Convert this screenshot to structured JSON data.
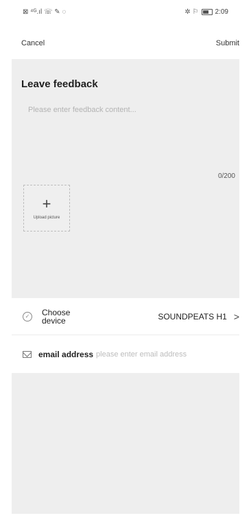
{
  "status_bar": {
    "left_icons": "⊠ ⁴ᴳ.ıl ☏ ✎ ◌",
    "right_icons": "✲ ⚐",
    "time": "2:09"
  },
  "nav": {
    "cancel_label": "Cancel",
    "submit_label": "Submit"
  },
  "feedback": {
    "title": "Leave feedback",
    "placeholder": "Please enter feedback content...",
    "counter": "0/200",
    "upload_label": "Upload picture"
  },
  "device": {
    "label": "Choose device",
    "value": "SOUNDPEATS H1"
  },
  "email": {
    "label": "email address",
    "placeholder": "please enter email address"
  }
}
